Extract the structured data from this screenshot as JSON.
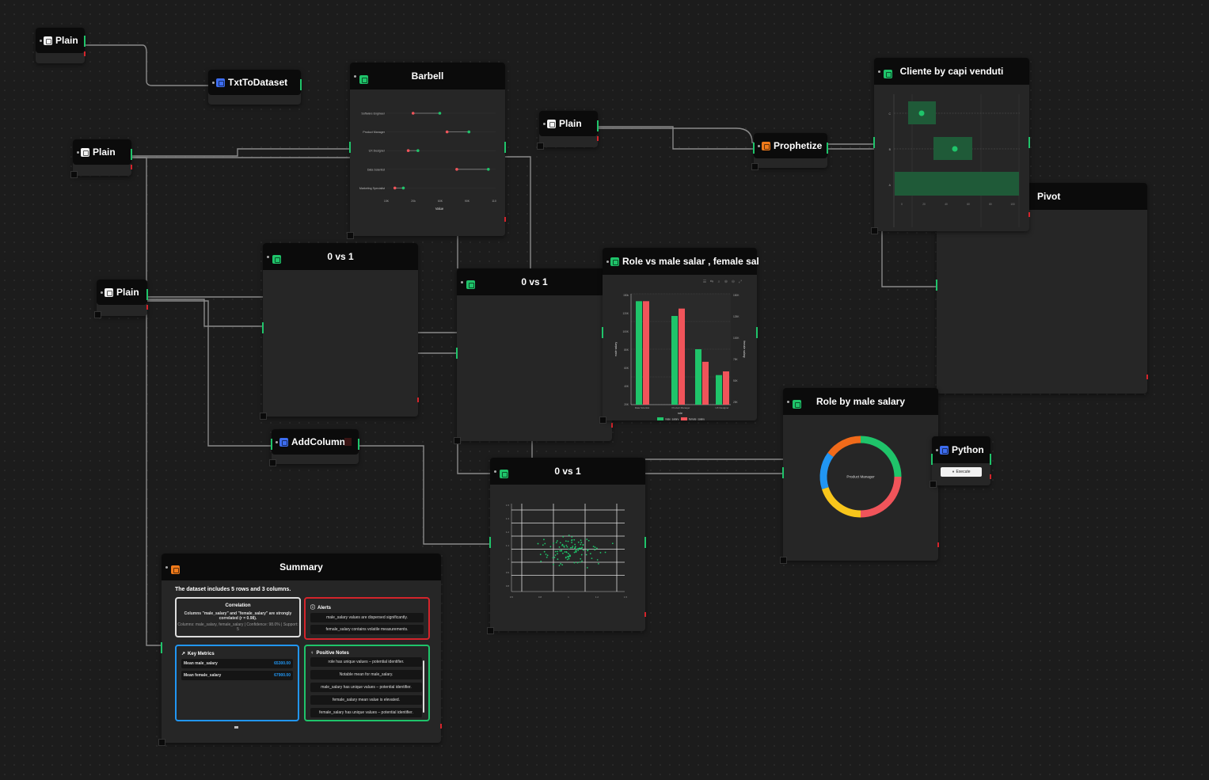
{
  "nodes": {
    "plain1": {
      "title": "Plain"
    },
    "txttodataset": {
      "title": "TxtToDataset"
    },
    "plain2": {
      "title": "Plain"
    },
    "plain3": {
      "title": "Plain"
    },
    "plain4": {
      "title": "Plain"
    },
    "barbell": {
      "title": "Barbell"
    },
    "zero_vs_one_a": {
      "title": "0 vs 1"
    },
    "zero_vs_one_b": {
      "title": "0 vs 1"
    },
    "zero_vs_one_c": {
      "title": "0 vs 1"
    },
    "addcolumn": {
      "title": "AddColumn"
    },
    "role_vs": {
      "title": "Role vs male salar , female sal"
    },
    "prophetize": {
      "title": "Prophetize"
    },
    "cliente": {
      "title": "Cliente by capi venduti"
    },
    "pivot": {
      "title": "Pivot"
    },
    "role_male": {
      "title": "Role by male salary",
      "center_label": "Product Manager"
    },
    "python": {
      "title": "Python",
      "button": "Execute"
    }
  },
  "summary": {
    "title": "Summary",
    "intro": "The dataset includes 5 rows and 3 columns.",
    "correlation": {
      "title": "Correlation",
      "text": "Columns \"male_salary\" and \"female_salary\" are strongly correlated (r = 0.98).",
      "sub": "Columns: male_salary, female_salary | Confidence: 98.0% | Support: 5"
    },
    "alerts": {
      "title": "Alerts",
      "items": [
        "male_salary values are dispersed significantly.",
        "female_salary contains volatile measurements."
      ]
    },
    "key_metrics": {
      "title": "Key Metrics",
      "rows": [
        {
          "label": "Mean male_salary",
          "value": "65300.00"
        },
        {
          "label": "Mean female_salary",
          "value": "67900.00"
        }
      ]
    },
    "positive": {
      "title": "Positive Notes",
      "items": [
        "role has unique values – potential identifier.",
        "Notable mean for male_salary.",
        "male_salary has unique values – potential identifier.",
        "female_salary mean value is elevated.",
        "female_salary has unique values – potential identifier."
      ]
    }
  },
  "colors": {
    "green": "#1fc46a",
    "red": "#f0545a",
    "blue": "#2196f3",
    "yellow": "#f8c61b",
    "orange": "#f06a1a"
  },
  "chart_data": [
    {
      "type": "barbell",
      "chart": "Barbell",
      "categories": [
        "Software Engineer",
        "Product Manager",
        "UX Designer",
        "Data Scientist",
        "Marketing Specialist"
      ],
      "series": [
        {
          "values": [
            52000,
            80000,
            48000,
            88000,
            37000
          ]
        },
        {
          "values": [
            74000,
            98000,
            56000,
            114000,
            44000
          ]
        }
      ],
      "xlabel": "Value"
    },
    {
      "type": "bar",
      "chart": "Role vs male salar , female sal",
      "categories": [
        "Data Scientist",
        "Product Manager",
        "UX Designer"
      ],
      "series": [
        {
          "name": "male_salary",
          "values": [
            140000,
            120000,
            75000,
            40000
          ]
        },
        {
          "name": "female_salary",
          "values": [
            140000,
            130000,
            58000,
            45000
          ]
        }
      ],
      "xlabel": "role",
      "ylabel": "male salary",
      "y2label": "female salary"
    },
    {
      "type": "scatter",
      "chart": "0 vs 1"
    },
    {
      "type": "donut",
      "chart": "Role by male salary",
      "values": [
        25,
        25,
        20,
        15,
        15
      ]
    },
    {
      "type": "boxplot",
      "chart": "Cliente by capi venduti",
      "categories": [
        "C",
        "B",
        "A"
      ]
    }
  ]
}
